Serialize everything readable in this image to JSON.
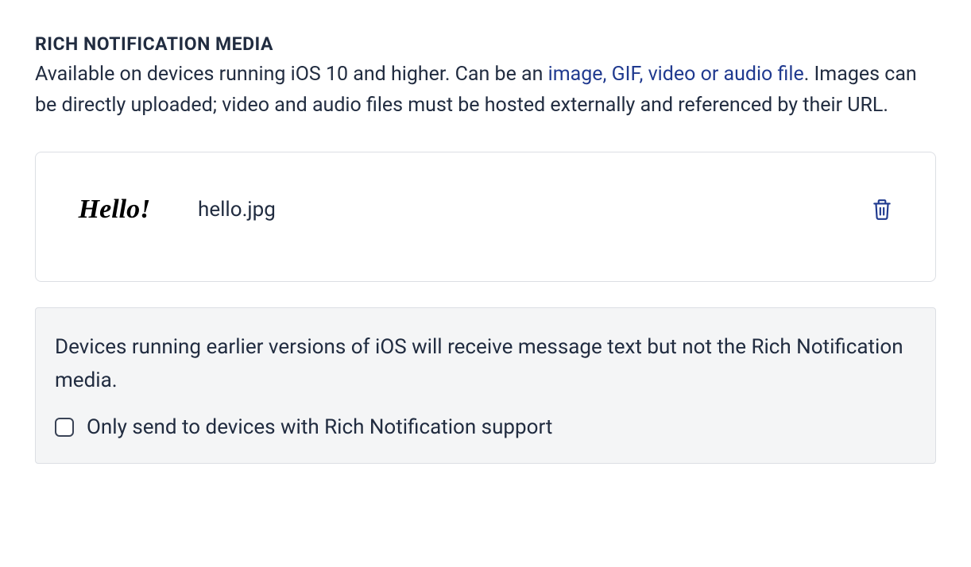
{
  "section": {
    "title": "RICH NOTIFICATION MEDIA",
    "description_pre": "Available on devices running iOS 10 and higher. Can be an ",
    "description_link": "image, GIF, video or audio file",
    "description_post": ". Images can be directly uploaded; video and audio files must be hosted externally and referenced by their URL."
  },
  "media": {
    "thumbnail_text": "Hello!",
    "filename": "hello.jpg"
  },
  "info": {
    "text": "Devices running earlier versions of iOS will receive message text but not the Rich Notification media.",
    "checkbox_label": "Only send to devices with Rich Notification support",
    "checked": false
  }
}
